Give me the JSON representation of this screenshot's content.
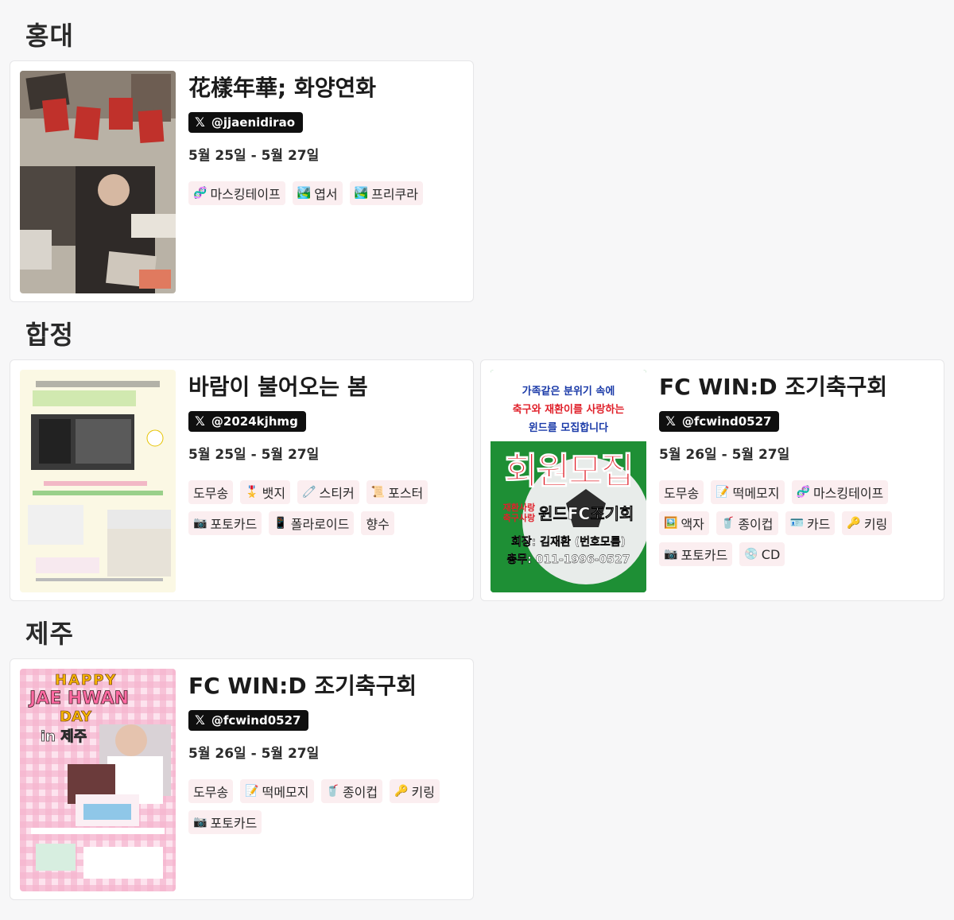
{
  "sections": [
    {
      "title": "홍대"
    },
    {
      "title": "합정"
    },
    {
      "title": "제주"
    }
  ],
  "cards": [
    {
      "title": "花樣年華; 화양연화",
      "handle": "@jjaenidirao",
      "dates": "5월 25일 - 5월 27일",
      "tags": [
        {
          "icon": "🧬",
          "label": "마스킹테이프"
        },
        {
          "icon": "🏞️",
          "label": "엽서"
        },
        {
          "icon": "🏞️",
          "label": "프리쿠라"
        }
      ]
    },
    {
      "title": "바람이 불어오는 봄",
      "handle": "@2024kjhmg",
      "dates": "5월 25일 - 5월 27일",
      "tags": [
        {
          "icon": "",
          "label": "도무송"
        },
        {
          "icon": "🎖️",
          "label": "뱃지"
        },
        {
          "icon": "🧷",
          "label": "스티커"
        },
        {
          "icon": "📜",
          "label": "포스터"
        },
        {
          "icon": "📷",
          "label": "포토카드"
        },
        {
          "icon": "📱",
          "label": "폴라로이드"
        },
        {
          "icon": "",
          "label": "향수"
        }
      ]
    },
    {
      "title": "FC WIN:D 조기축구회",
      "handle": "@fcwind0527",
      "dates": "5월 26일 - 5월 27일",
      "tags": [
        {
          "icon": "",
          "label": "도무송"
        },
        {
          "icon": "📝",
          "label": "떡메모지"
        },
        {
          "icon": "🧬",
          "label": "마스킹테이프"
        },
        {
          "icon": "🖼️",
          "label": "액자"
        },
        {
          "icon": "🥤",
          "label": "종이컵"
        },
        {
          "icon": "🪪",
          "label": "카드"
        },
        {
          "icon": "🔑",
          "label": "키링"
        },
        {
          "icon": "📷",
          "label": "포토카드"
        },
        {
          "icon": "💿",
          "label": "CD"
        }
      ],
      "poster": {
        "line1": "가족같은 분위기 속에",
        "line2": "축구와 재환이를 사랑하는",
        "line3": "윈드를 모집합니다",
        "big": "회원모집",
        "side1": "재환사랑",
        "side2": "축구사랑",
        "club": "윈드FC조기회",
        "chair": "회장: 김재환 (번호모름)",
        "sec": "총무: 011-1996-0527"
      }
    },
    {
      "title": "FC WIN:D 조기축구회",
      "handle": "@fcwind0527",
      "dates": "5월 26일 - 5월 27일",
      "tags": [
        {
          "icon": "",
          "label": "도무송"
        },
        {
          "icon": "📝",
          "label": "떡메모지"
        },
        {
          "icon": "🥤",
          "label": "종이컵"
        },
        {
          "icon": "🔑",
          "label": "키링"
        },
        {
          "icon": "📷",
          "label": "포토카드"
        }
      ],
      "poster": {
        "happy": "HAPPY",
        "name": "JAE HWAN",
        "day": "DAY",
        "place": "in 제주"
      }
    }
  ],
  "colors": {
    "tag_bg": "#fbeef0",
    "handle_bg": "#0f0f0f",
    "poster_green": "#1f9a3a",
    "poster_red": "#e0202a"
  }
}
